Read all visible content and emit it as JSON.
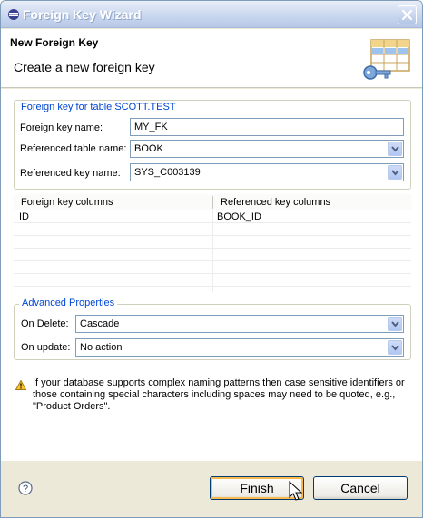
{
  "window": {
    "title": "Foreign Key Wizard"
  },
  "banner": {
    "title": "New Foreign Key",
    "subtitle": "Create a new foreign key"
  },
  "fk_group": {
    "legend": "Foreign key for table SCOTT.TEST",
    "name_label": "Foreign key name:",
    "name_value": "MY_FK",
    "ref_table_label": "Referenced table name:",
    "ref_table_value": "BOOK",
    "ref_key_label": "Referenced key name:",
    "ref_key_value": "SYS_C003139"
  },
  "columns_table": {
    "headers": [
      "Foreign key columns",
      "Referenced key columns"
    ],
    "rows": [
      [
        "ID",
        "BOOK_ID"
      ]
    ]
  },
  "advanced": {
    "legend": "Advanced Properties",
    "on_delete_label": "On Delete:",
    "on_delete_value": "Cascade",
    "on_update_label": "On update:",
    "on_update_value": "No action"
  },
  "warning": {
    "text": "If your database supports complex naming patterns then case sensitive identifiers or those containing special characters including spaces may need to be quoted, e.g., \"Product Orders\"."
  },
  "footer": {
    "finish_label": "Finish",
    "cancel_label": "Cancel"
  },
  "colors": {
    "legend_blue": "#0046d5",
    "default_button_ring": "#f8b94d",
    "dialog_background": "#ece9d8"
  },
  "icons": [
    "app-icon",
    "close-icon",
    "table-key-icon",
    "chevron-down-icon",
    "warning-icon",
    "help-icon",
    "mouse-pointer-icon"
  ]
}
